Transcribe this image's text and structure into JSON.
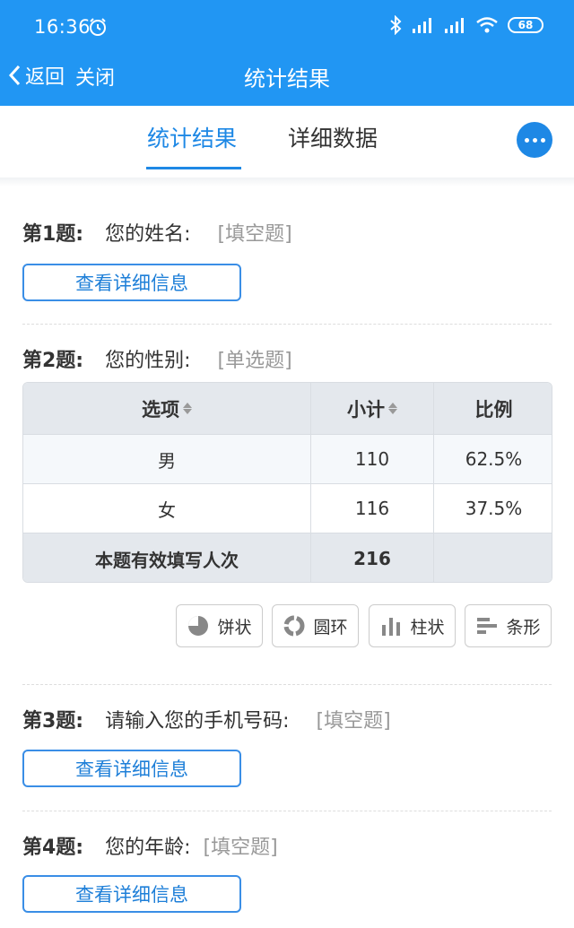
{
  "status": {
    "time": "16:36",
    "battery": "68"
  },
  "nav": {
    "back_label": "返回",
    "close_label": "关闭",
    "title": "统计结果"
  },
  "tabs": [
    {
      "label": "统计结果",
      "active": true
    },
    {
      "label": "详细数据",
      "active": false
    }
  ],
  "questions": [
    {
      "num": "第1题:",
      "text": "您的姓名:",
      "type": "[填空题]",
      "button": "查看详细信息"
    },
    {
      "num": "第2题:",
      "text": "您的性别:",
      "type": "[单选题]"
    },
    {
      "num": "第3题:",
      "text": "请输入您的手机号码:",
      "type": "[填空题]",
      "button": "查看详细信息"
    },
    {
      "num": "第4题:",
      "text": "您的年龄:",
      "type": "[填空题]",
      "button": "查看详细信息"
    }
  ],
  "table": {
    "headers": {
      "option": "选项",
      "count": "小计",
      "ratio": "比例"
    },
    "rows": [
      {
        "option": "男",
        "count": "110",
        "ratio": "62.5%"
      },
      {
        "option": "女",
        "count": "116",
        "ratio": "37.5%"
      }
    ],
    "footer": {
      "label": "本题有效填写人次",
      "count": "216"
    }
  },
  "chart_buttons": [
    {
      "label": "饼状",
      "icon": "pie-chart-icon"
    },
    {
      "label": "圆环",
      "icon": "donut-chart-icon"
    },
    {
      "label": "柱状",
      "icon": "bar-chart-icon"
    },
    {
      "label": "条形",
      "icon": "horizontal-bar-icon"
    }
  ],
  "colors": {
    "primary": "#2196f3",
    "accent": "#1e88e5"
  }
}
